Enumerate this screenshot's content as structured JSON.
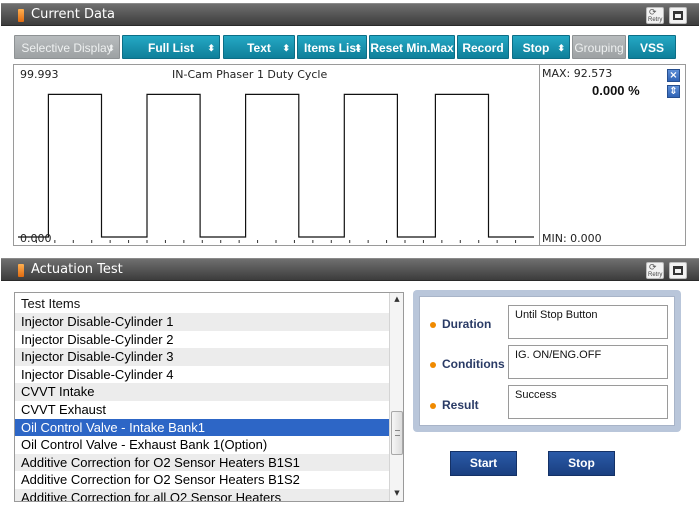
{
  "current_data": {
    "title": "Current Data",
    "retry_label": "Retry",
    "toolbar": [
      {
        "label": "Selective Display",
        "dropdown": true,
        "enabled": false
      },
      {
        "label": "Full List",
        "dropdown": true,
        "enabled": true
      },
      {
        "label": "Text",
        "dropdown": true,
        "enabled": true
      },
      {
        "label": "Items List",
        "dropdown": true,
        "enabled": true
      },
      {
        "label": "Reset Min.Max",
        "dropdown": false,
        "enabled": true
      },
      {
        "label": "Record",
        "dropdown": false,
        "enabled": true
      },
      {
        "label": "Stop",
        "dropdown": true,
        "enabled": true
      },
      {
        "label": "Grouping",
        "dropdown": false,
        "enabled": false
      },
      {
        "label": "VSS",
        "dropdown": false,
        "enabled": true
      }
    ],
    "graph": {
      "top_label": "99.993",
      "bottom_label": "0.000",
      "signal_name": "IN-Cam Phaser 1 Duty Cycle",
      "max_label": "MAX: 92.573",
      "min_label": "MIN: 0.000",
      "value": "0.000 %",
      "close_glyph": "×",
      "updown_glyph": "⇕"
    },
    "chart_data": {
      "type": "line",
      "title": "IN-Cam Phaser 1 Duty Cycle",
      "ylim": [
        0,
        99.993
      ],
      "x": [
        0,
        4,
        4,
        11,
        11,
        17,
        17,
        24,
        24,
        30,
        30,
        37,
        37,
        43,
        43,
        50,
        50,
        55,
        55,
        62,
        62,
        68
      ],
      "values": [
        0,
        0,
        92.573,
        92.573,
        0,
        0,
        92.573,
        92.573,
        0,
        0,
        92.573,
        92.573,
        0,
        0,
        92.573,
        92.573,
        0,
        0,
        92.573,
        92.573,
        0,
        0
      ],
      "grid": false
    }
  },
  "actuation": {
    "title": "Actuation Test",
    "retry_label": "Retry",
    "list_header": "Test Items",
    "items": [
      "Injector Disable-Cylinder 1",
      "Injector Disable-Cylinder 2",
      "Injector Disable-Cylinder 3",
      "Injector Disable-Cylinder 4",
      "CVVT Intake",
      "CVVT Exhaust",
      "Oil Control Valve - Intake Bank1",
      "Oil Control Valve - Exhaust Bank 1(Option)",
      "Additive Correction for O2 Sensor Heaters B1S1",
      "Additive Correction for O2 Sensor Heaters B1S2",
      "Additive Correction for all O2 Sensor Heaters"
    ],
    "selected_index": 6,
    "info": {
      "duration_label": "Duration",
      "duration_value": "Until Stop Button",
      "conditions_label": "Conditions",
      "conditions_value": "IG. ON/ENG.OFF",
      "result_label": "Result",
      "result_value": "Success"
    },
    "start_label": "Start",
    "stop_label": "Stop"
  },
  "colors": {
    "accent": "#1a93b0",
    "selection": "#2d66c6",
    "bullet": "#f08a00",
    "action_button": "#1f4a92"
  }
}
